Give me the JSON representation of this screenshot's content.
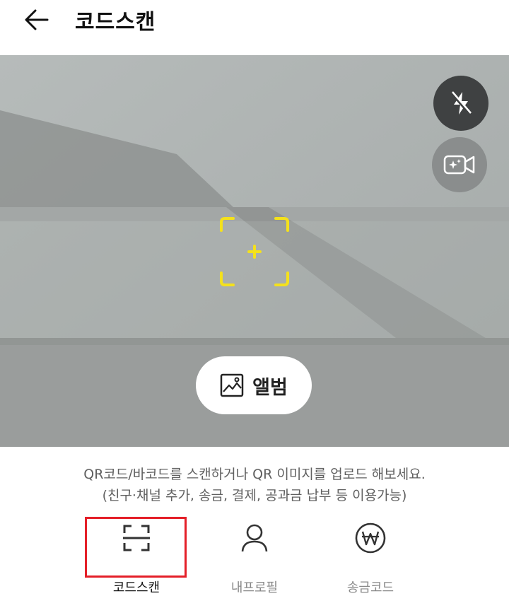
{
  "header": {
    "title": "코드스캔",
    "back_icon": "arrow-left-icon"
  },
  "camera": {
    "flash_icon": "flash-off-icon",
    "video_icon": "video-sparkle-icon",
    "finder_color": "#f4e11c",
    "album_label": "앨범",
    "album_icon": "image-icon"
  },
  "info": {
    "line1": "QR코드/바코드를 스캔하거나 QR 이미지를 업로드 해보세요.",
    "line2": "(친구·채널 추가, 송금, 결제, 공과금 납부 등 이용가능)"
  },
  "tabs": [
    {
      "label": "코드스캔",
      "icon": "scan-frame-icon",
      "active": true
    },
    {
      "label": "내프로필",
      "icon": "person-icon",
      "active": false
    },
    {
      "label": "송금코드",
      "icon": "won-circle-icon",
      "active": false
    }
  ],
  "colors": {
    "highlight": "#e41f28",
    "active_text": "#111111",
    "inactive_text": "#888888"
  }
}
